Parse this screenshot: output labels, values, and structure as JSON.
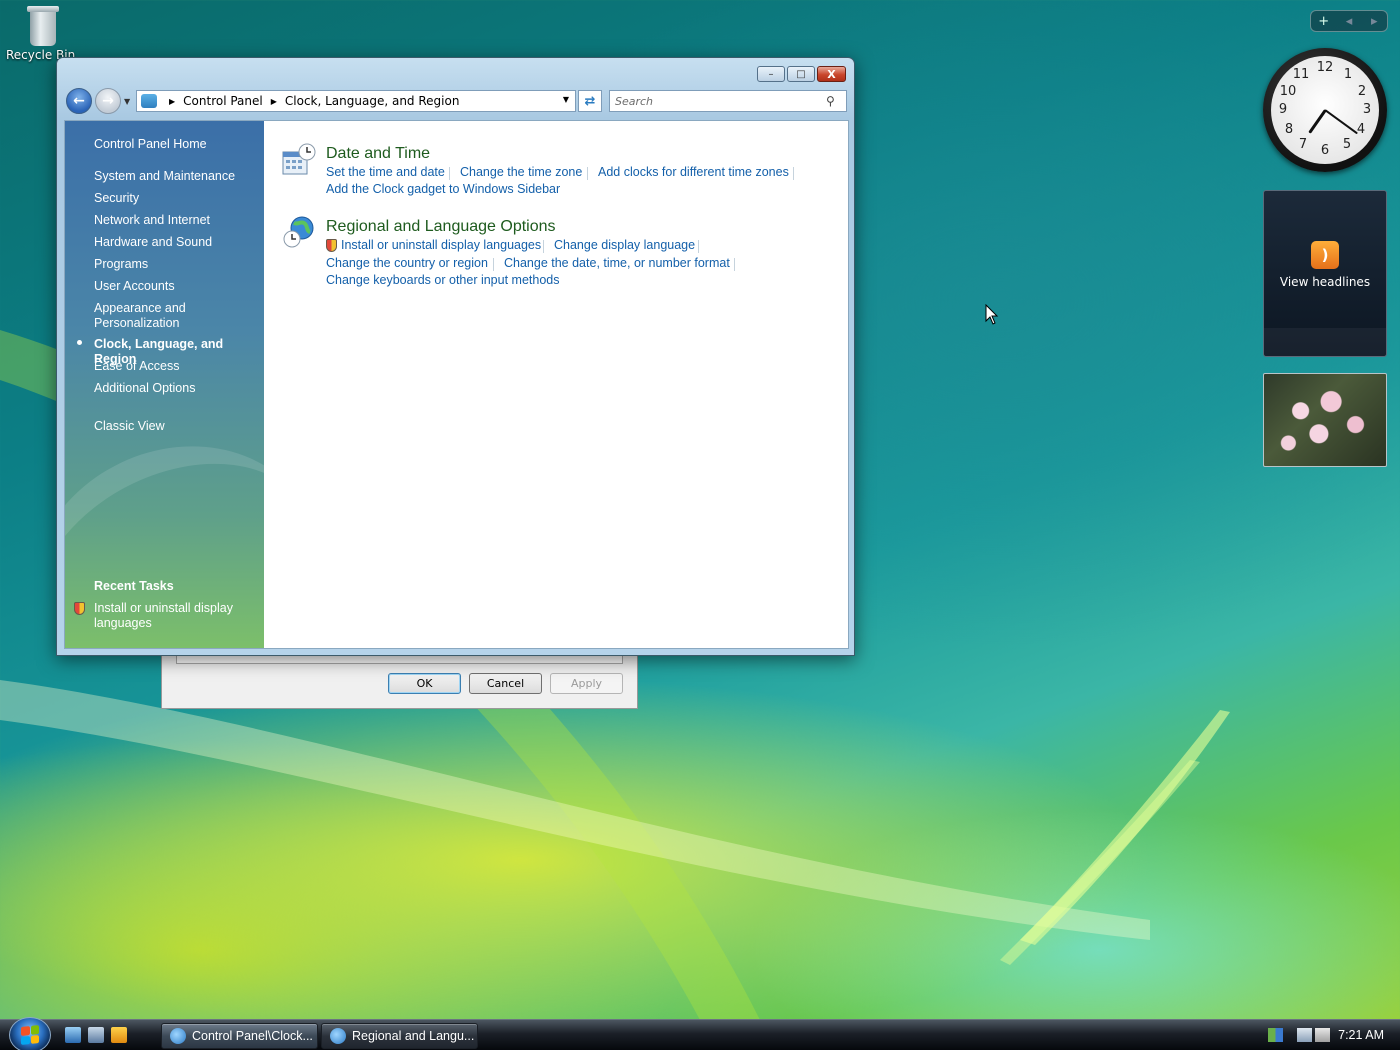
{
  "desktop": {
    "recycle_bin_label": "Recycle Bin"
  },
  "sidebar_gadgets": {
    "controls": {
      "add": "+",
      "prev": "◂",
      "next": "▸"
    },
    "clock_numbers": [
      "12",
      "1",
      "2",
      "3",
      "4",
      "5",
      "6",
      "7",
      "8",
      "9",
      "10",
      "11"
    ],
    "clock_time": "7:21",
    "feed_label": "View headlines"
  },
  "back_dialog": {
    "ok_label": "OK",
    "cancel_label": "Cancel",
    "apply_label": "Apply"
  },
  "window": {
    "caption": {
      "minimize": "–",
      "maximize": "□",
      "close": "X"
    },
    "breadcrumb": [
      "Control Panel",
      "Clock, Language, and Region"
    ],
    "search_placeholder": "Search",
    "nav_items": [
      "Control Panel Home",
      "System and Maintenance",
      "Security",
      "Network and Internet",
      "Hardware and Sound",
      "Programs",
      "User Accounts",
      "Appearance and Personalization",
      "Clock, Language, and Region",
      "Ease of Access",
      "Additional Options",
      "Classic View"
    ],
    "recent_tasks_header": "Recent Tasks",
    "recent_task": "Install or uninstall display languages",
    "categories": [
      {
        "title": "Date and Time",
        "links": [
          "Set the time and date",
          "Change the time zone",
          "Add clocks for different time zones",
          "Add the Clock gadget to Windows Sidebar"
        ]
      },
      {
        "title": "Regional and Language Options",
        "links": [
          "Install or uninstall display languages",
          "Change display language",
          "Change the country or region",
          "Change the date, time, or number format",
          "Change keyboards or other input methods"
        ]
      }
    ]
  },
  "taskbar": {
    "tasks": [
      "Control Panel\\Clock...",
      "Regional and Langu..."
    ],
    "time": "7:21 AM"
  },
  "colors": {
    "link_blue": "#1460aa",
    "category_green": "#1e5b1e",
    "nav_pane_top": "#3b6fa8",
    "nav_pane_bottom": "#7cbf6a"
  }
}
